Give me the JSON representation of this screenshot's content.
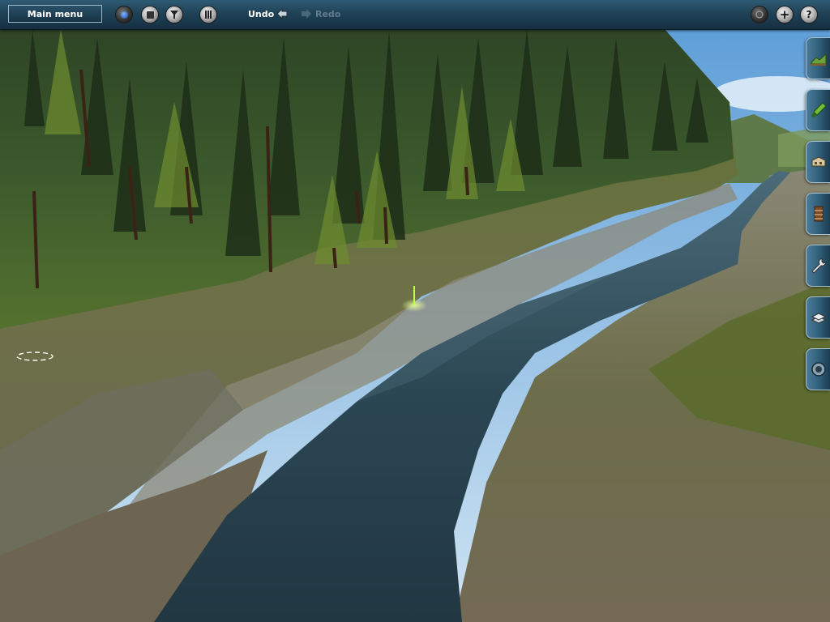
{
  "toolbar": {
    "main_menu_label": "Main menu",
    "undo_label": "Undo",
    "redo_label": "Redo",
    "left_buttons": [
      "lighting-icon",
      "stop-icon",
      "filter-icon",
      "grid-icon"
    ],
    "right_buttons": [
      "camera-icon",
      "plus-icon",
      "help-icon"
    ],
    "help_glyph": "?",
    "plus_glyph": "+"
  },
  "side_tools": [
    {
      "name": "tab-terrain",
      "icon": "terrain-icon"
    },
    {
      "name": "tab-paint",
      "icon": "paint-icon"
    },
    {
      "name": "tab-objects",
      "icon": "building-icon"
    },
    {
      "name": "tab-track",
      "icon": "track-icon"
    },
    {
      "name": "tab-tools",
      "icon": "wrench-icon"
    },
    {
      "name": "tab-layers",
      "icon": "layers-icon"
    },
    {
      "name": "tab-settings",
      "icon": "settings-icon"
    }
  ],
  "colors": {
    "toolbar": "#1f4257",
    "water": "#2a4450",
    "grass": "#4a5e2a",
    "rock": "#7d7a64",
    "sky": "#8fc0e6"
  }
}
